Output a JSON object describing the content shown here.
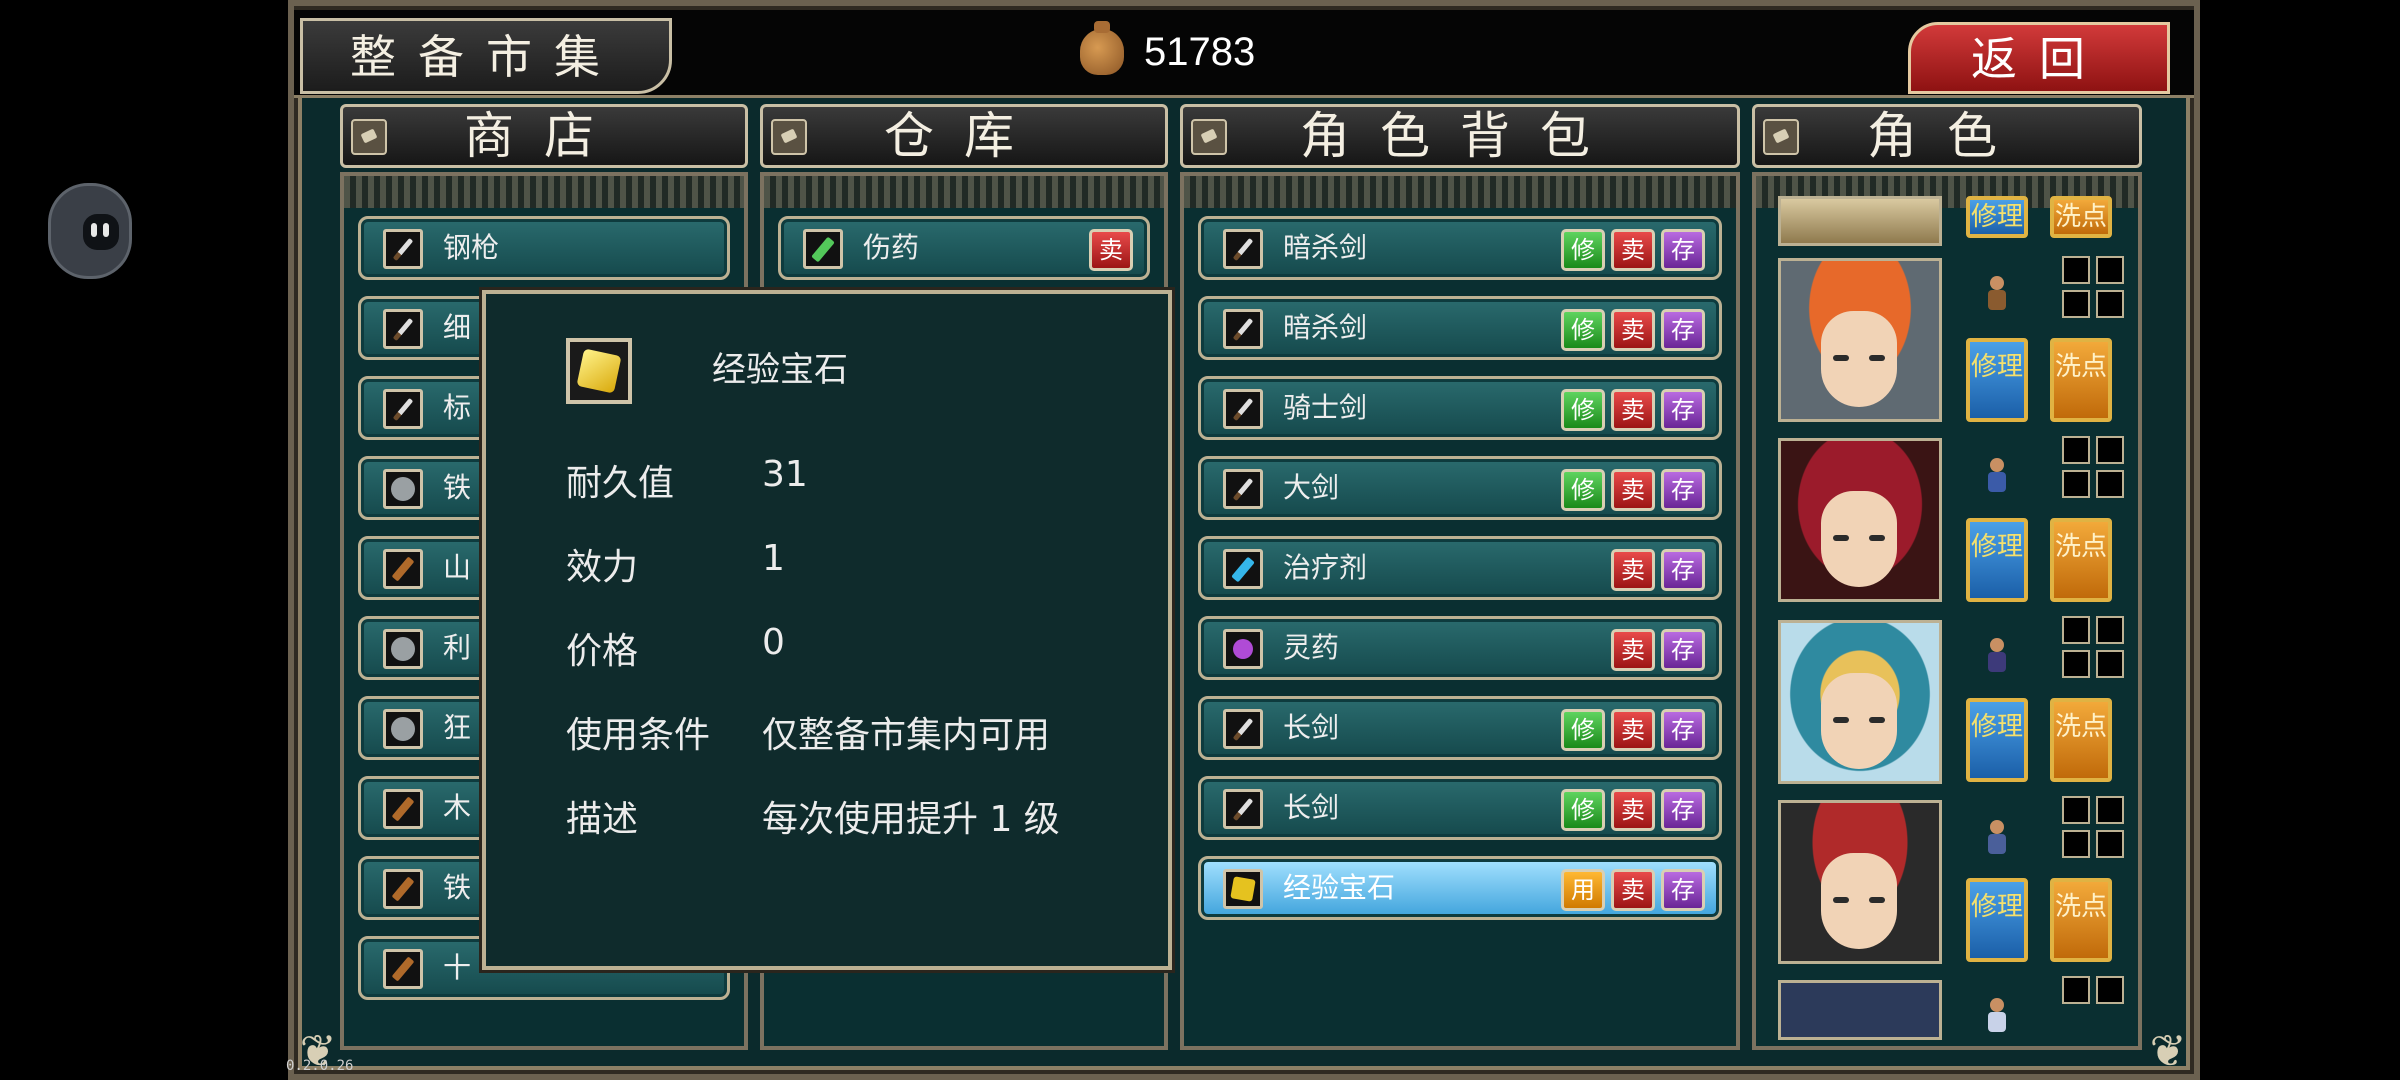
{
  "title": "整备市集",
  "money": "51783",
  "back_label": "返回",
  "columns": {
    "shop": "商店",
    "warehouse": "仓库",
    "bag": "角色背包",
    "roles": "角色"
  },
  "shop_items": [
    "钢枪",
    "细",
    "标",
    "铁",
    "山",
    "利",
    "狂",
    "木",
    "铁",
    "十"
  ],
  "warehouse_items": [
    {
      "name": "伤药",
      "sell": "卖"
    }
  ],
  "bag_items": [
    {
      "name": "暗杀剑",
      "actions": [
        "修",
        "卖",
        "存"
      ]
    },
    {
      "name": "暗杀剑",
      "actions": [
        "修",
        "卖",
        "存"
      ]
    },
    {
      "name": "骑士剑",
      "actions": [
        "修",
        "卖",
        "存"
      ]
    },
    {
      "name": "大剑",
      "actions": [
        "修",
        "卖",
        "存"
      ]
    },
    {
      "name": "治疗剂",
      "actions": [
        "卖",
        "存"
      ]
    },
    {
      "name": "灵药",
      "actions": [
        "卖",
        "存"
      ]
    },
    {
      "name": "长剑",
      "actions": [
        "修",
        "卖",
        "存"
      ]
    },
    {
      "name": "长剑",
      "actions": [
        "修",
        "卖",
        "存"
      ]
    },
    {
      "name": "经验宝石",
      "actions": [
        "用",
        "卖",
        "存"
      ]
    }
  ],
  "popup": {
    "name": "经验宝石",
    "durability_label": "耐久值",
    "durability": "31",
    "power_label": "效力",
    "power": "1",
    "price_label": "价格",
    "price": "0",
    "condition_label": "使用条件",
    "condition": "仅整备市集内可用",
    "desc_label": "描述",
    "desc": "每次使用提升 1 级"
  },
  "role_buttons": {
    "repair": "修理",
    "wash": "洗点"
  },
  "version": "0.2.0.26"
}
